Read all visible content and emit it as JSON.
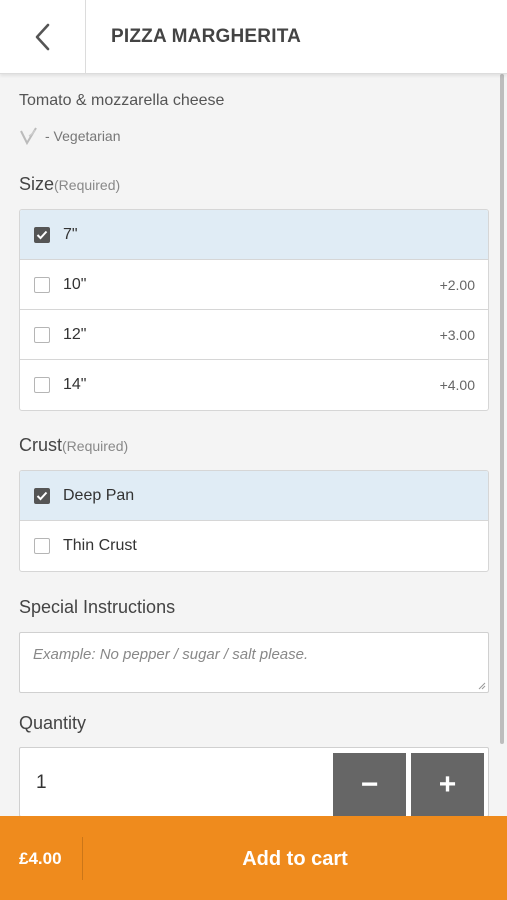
{
  "header": {
    "title": "PIZZA MARGHERITA",
    "back_icon": "chevron-left-icon"
  },
  "item": {
    "description": "Tomato & mozzarella cheese",
    "tag": "- Vegetarian",
    "tag_icon": "vegetarian-v-icon"
  },
  "size": {
    "label": "Size",
    "required": "(Required)",
    "options": [
      {
        "label": "7\"",
        "price": "",
        "selected": true
      },
      {
        "label": "10\"",
        "price": "+2.00",
        "selected": false
      },
      {
        "label": "12\"",
        "price": "+3.00",
        "selected": false
      },
      {
        "label": "14\"",
        "price": "+4.00",
        "selected": false
      }
    ]
  },
  "crust": {
    "label": "Crust",
    "required": "(Required)",
    "options": [
      {
        "label": "Deep Pan",
        "selected": true
      },
      {
        "label": "Thin Crust",
        "selected": false
      }
    ]
  },
  "instructions": {
    "label": "Special Instructions",
    "placeholder": "Example: No pepper / sugar / salt please."
  },
  "quantity": {
    "label": "Quantity",
    "value": "1",
    "minus_label": "−",
    "plus_label": "+"
  },
  "footer": {
    "price": "£4.00",
    "add_label": "Add to cart"
  },
  "colors": {
    "accent": "#ef8b1d",
    "selected_row": "#e0ecf5",
    "qty_button": "#666666"
  }
}
